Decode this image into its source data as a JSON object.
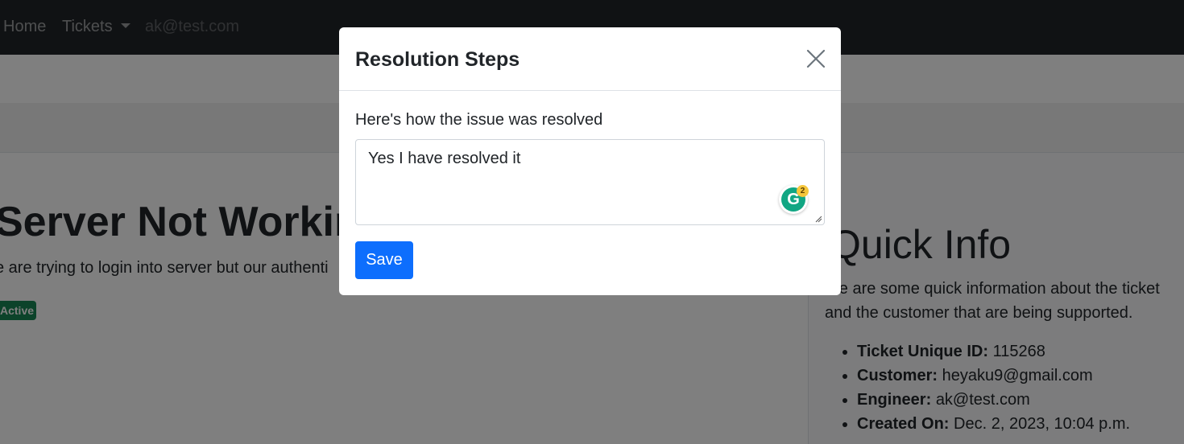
{
  "navbar": {
    "home": "Home",
    "tickets": "Tickets",
    "user_email": "ak@test.com"
  },
  "ticket": {
    "title": "Server Not Workin",
    "description": "e are trying to login into server but our authenti",
    "status_badge": "Active"
  },
  "quick_info": {
    "title": "Quick Info",
    "intro": "ere are some quick information about the ticket and the customer that are being supported.",
    "items": [
      {
        "label": "Ticket Unique ID:",
        "value": "115268"
      },
      {
        "label": "Customer:",
        "value": "heyaku9@gmail.com"
      },
      {
        "label": "Engineer:",
        "value": "ak@test.com"
      },
      {
        "label": "Created On:",
        "value": "Dec. 2, 2023, 10:04 p.m."
      }
    ]
  },
  "modal": {
    "title": "Resolution Steps",
    "label": "Here's how the issue was resolved",
    "textarea_value": "Yes I have resolved it",
    "grammarly_count": "2",
    "save_label": "Save"
  },
  "colors": {
    "navbar_bg": "#212529",
    "primary": "#0d6efd",
    "success": "#198754",
    "backdrop": "rgba(0,0,0,0.5)"
  }
}
